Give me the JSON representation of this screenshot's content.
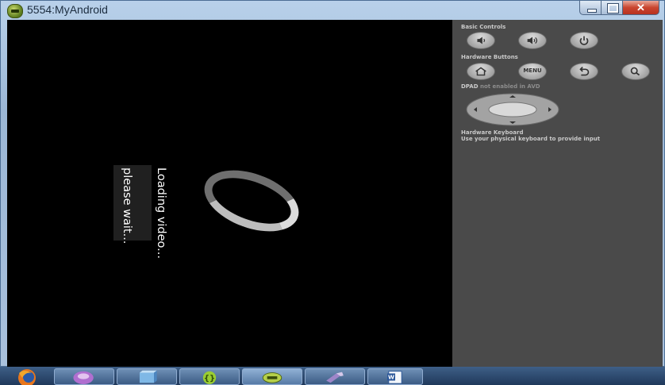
{
  "window": {
    "title": "5554:MyAndroid",
    "close_glyph": "✕"
  },
  "device": {
    "dialog_message": "please wait...",
    "dialog_title": "Loading video..."
  },
  "controls": {
    "basic_controls_label": "Basic Controls",
    "hardware_buttons_label": "Hardware Buttons",
    "menu_label": "MENU",
    "dpad_label_bold": "DPAD",
    "dpad_label_rest": " not enabled in AVD",
    "keyboard_label": "Hardware Keyboard",
    "keyboard_hint": "Use your physical keyboard to provide input",
    "buttons": [
      "volume-down-icon",
      "volume-up-icon",
      "power-icon",
      "home-icon",
      "menu-button",
      "back-icon",
      "search-icon"
    ]
  },
  "taskbar": {
    "items": [
      "firefox-icon",
      "media-icon",
      "box-icon",
      "braces-icon",
      "android-icon",
      "tool-icon",
      "word-icon"
    ]
  },
  "colors": {
    "screen": "#000000",
    "controls_panel": "#4a4a4a",
    "window_chrome": "#b9d1ea"
  }
}
